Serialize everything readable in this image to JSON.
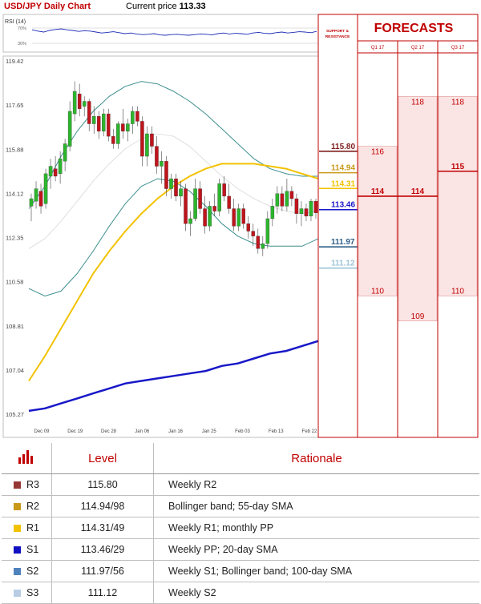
{
  "header": {
    "title": "USD/JPY Daily Chart",
    "current_label": "Current price",
    "current_value": "113.33"
  },
  "chart_data": {
    "type": "candlestick",
    "rsi_label": "RSI (14)",
    "rsi_levels": [
      "70%",
      "30%"
    ],
    "rsi_values": [
      62,
      58,
      55,
      60,
      63,
      65,
      62,
      60,
      57,
      59,
      58,
      55,
      52,
      54,
      56,
      53,
      50,
      52,
      49,
      47,
      48,
      50,
      46,
      45,
      47,
      48,
      46,
      45,
      47,
      49,
      48,
      46,
      50,
      52,
      49,
      51,
      50,
      48,
      52,
      54,
      51,
      50,
      53,
      55,
      52,
      54,
      56,
      55,
      53,
      57
    ],
    "y_ticks": [
      "119.42",
      "117.65",
      "115.88",
      "114.12",
      "112.35",
      "110.58",
      "108.81",
      "107.04",
      "105.27"
    ],
    "ylim": [
      105.27,
      119.42
    ],
    "x_ticks": [
      "Dec 09",
      "Dec 19",
      "Dec 28",
      "Jan 06",
      "Jan 16",
      "Jan 25",
      "Feb 03",
      "Feb 13",
      "Feb 22"
    ],
    "candles": [
      {
        "o": 113.6,
        "h": 114.1,
        "l": 113.0,
        "c": 113.9
      },
      {
        "o": 113.8,
        "h": 114.6,
        "l": 113.5,
        "c": 114.3
      },
      {
        "o": 114.2,
        "h": 114.5,
        "l": 113.3,
        "c": 113.6
      },
      {
        "o": 113.7,
        "h": 115.1,
        "l": 113.5,
        "c": 114.9
      },
      {
        "o": 114.8,
        "h": 115.5,
        "l": 114.3,
        "c": 115.2
      },
      {
        "o": 115.1,
        "h": 115.6,
        "l": 114.6,
        "c": 114.8
      },
      {
        "o": 114.9,
        "h": 115.8,
        "l": 114.5,
        "c": 115.5
      },
      {
        "o": 115.4,
        "h": 116.3,
        "l": 115.0,
        "c": 116.1
      },
      {
        "o": 116.0,
        "h": 117.8,
        "l": 115.8,
        "c": 117.4
      },
      {
        "o": 117.3,
        "h": 118.6,
        "l": 117.0,
        "c": 118.2
      },
      {
        "o": 118.1,
        "h": 118.5,
        "l": 117.2,
        "c": 117.5
      },
      {
        "o": 117.6,
        "h": 118.0,
        "l": 117.2,
        "c": 117.8
      },
      {
        "o": 117.8,
        "h": 117.9,
        "l": 116.6,
        "c": 116.9
      },
      {
        "o": 116.9,
        "h": 117.6,
        "l": 116.5,
        "c": 117.2
      },
      {
        "o": 117.2,
        "h": 117.4,
        "l": 116.3,
        "c": 116.6
      },
      {
        "o": 116.6,
        "h": 117.5,
        "l": 116.4,
        "c": 117.3
      },
      {
        "o": 117.3,
        "h": 117.5,
        "l": 116.2,
        "c": 116.4
      },
      {
        "o": 116.4,
        "h": 116.7,
        "l": 115.9,
        "c": 116.1
      },
      {
        "o": 116.1,
        "h": 117.0,
        "l": 115.9,
        "c": 116.9
      },
      {
        "o": 116.9,
        "h": 117.5,
        "l": 116.3,
        "c": 116.6
      },
      {
        "o": 116.6,
        "h": 117.1,
        "l": 116.2,
        "c": 116.9
      },
      {
        "o": 116.9,
        "h": 117.6,
        "l": 116.5,
        "c": 117.4
      },
      {
        "o": 117.4,
        "h": 117.6,
        "l": 116.8,
        "c": 117.0
      },
      {
        "o": 117.0,
        "h": 117.2,
        "l": 115.2,
        "c": 115.6
      },
      {
        "o": 115.6,
        "h": 116.8,
        "l": 115.2,
        "c": 116.5
      },
      {
        "o": 116.5,
        "h": 116.8,
        "l": 115.7,
        "c": 116.0
      },
      {
        "o": 116.0,
        "h": 116.4,
        "l": 114.9,
        "c": 115.2
      },
      {
        "o": 115.2,
        "h": 115.8,
        "l": 114.5,
        "c": 115.4
      },
      {
        "o": 115.4,
        "h": 115.6,
        "l": 114.0,
        "c": 114.3
      },
      {
        "o": 114.3,
        "h": 114.9,
        "l": 113.9,
        "c": 114.7
      },
      {
        "o": 114.7,
        "h": 114.9,
        "l": 113.8,
        "c": 114.0
      },
      {
        "o": 114.0,
        "h": 114.6,
        "l": 113.6,
        "c": 114.3
      },
      {
        "o": 114.3,
        "h": 114.5,
        "l": 112.6,
        "c": 112.9
      },
      {
        "o": 112.9,
        "h": 113.4,
        "l": 112.4,
        "c": 113.1
      },
      {
        "o": 113.1,
        "h": 114.7,
        "l": 113.0,
        "c": 114.3
      },
      {
        "o": 114.3,
        "h": 114.6,
        "l": 113.3,
        "c": 113.5
      },
      {
        "o": 113.5,
        "h": 114.0,
        "l": 112.5,
        "c": 112.8
      },
      {
        "o": 112.8,
        "h": 113.8,
        "l": 112.6,
        "c": 113.6
      },
      {
        "o": 113.6,
        "h": 114.1,
        "l": 113.2,
        "c": 113.4
      },
      {
        "o": 113.4,
        "h": 114.7,
        "l": 113.2,
        "c": 114.5
      },
      {
        "o": 114.5,
        "h": 114.8,
        "l": 113.8,
        "c": 114.0
      },
      {
        "o": 114.0,
        "h": 114.5,
        "l": 113.3,
        "c": 113.5
      },
      {
        "o": 113.5,
        "h": 113.9,
        "l": 112.6,
        "c": 112.8
      },
      {
        "o": 112.8,
        "h": 113.7,
        "l": 112.6,
        "c": 113.5
      },
      {
        "o": 113.5,
        "h": 113.7,
        "l": 112.7,
        "c": 112.9
      },
      {
        "o": 112.9,
        "h": 113.2,
        "l": 112.3,
        "c": 112.6
      },
      {
        "o": 112.6,
        "h": 112.9,
        "l": 112.0,
        "c": 112.4
      },
      {
        "o": 112.4,
        "h": 112.7,
        "l": 111.7,
        "c": 111.9
      },
      {
        "o": 111.9,
        "h": 112.4,
        "l": 111.6,
        "c": 112.1
      },
      {
        "o": 112.1,
        "h": 113.4,
        "l": 111.9,
        "c": 113.1
      },
      {
        "o": 113.1,
        "h": 113.9,
        "l": 112.8,
        "c": 113.6
      },
      {
        "o": 113.6,
        "h": 114.4,
        "l": 113.3,
        "c": 114.1
      },
      {
        "o": 114.1,
        "h": 114.4,
        "l": 113.4,
        "c": 113.6
      },
      {
        "o": 113.6,
        "h": 114.7,
        "l": 113.4,
        "c": 114.2
      },
      {
        "o": 114.2,
        "h": 114.4,
        "l": 113.6,
        "c": 113.9
      },
      {
        "o": 113.9,
        "h": 114.1,
        "l": 112.9,
        "c": 113.3
      },
      {
        "o": 113.3,
        "h": 113.8,
        "l": 112.8,
        "c": 113.5
      },
      {
        "o": 113.5,
        "h": 113.7,
        "l": 113.0,
        "c": 113.2
      },
      {
        "o": 113.2,
        "h": 113.9,
        "l": 113.0,
        "c": 113.8
      },
      {
        "o": 113.8,
        "h": 113.9,
        "l": 113.1,
        "c": 113.33
      }
    ],
    "indicators": {
      "bb_upper": [
        113.5,
        114.4,
        115.6,
        116.6,
        117.4,
        118.0,
        118.4,
        118.6,
        118.5,
        118.2,
        117.8,
        117.3,
        116.7,
        116.1,
        115.5,
        115.1,
        114.9,
        114.8,
        114.8
      ],
      "bb_lower": [
        110.3,
        110.0,
        110.2,
        110.9,
        111.8,
        112.8,
        113.7,
        114.4,
        114.7,
        114.6,
        114.2,
        113.6,
        112.9,
        112.4,
        112.1,
        112.0,
        112.0,
        112.0,
        112.3
      ],
      "bb_mid": [
        111.9,
        112.3,
        113.0,
        113.8,
        114.6,
        115.3,
        115.9,
        116.3,
        116.5,
        116.4,
        116.0,
        115.4,
        114.8,
        114.3,
        113.9,
        113.6,
        113.4,
        113.3,
        113.4
      ],
      "sma55": [
        106.6,
        107.6,
        108.7,
        109.8,
        110.9,
        111.8,
        112.6,
        113.3,
        113.9,
        114.4,
        114.8,
        115.1,
        115.3,
        115.3,
        115.3,
        115.2,
        115.1,
        114.9,
        114.7
      ],
      "sma100": [
        105.4,
        105.5,
        105.7,
        105.9,
        106.1,
        106.3,
        106.5,
        106.6,
        106.7,
        106.8,
        106.9,
        107.0,
        107.2,
        107.3,
        107.5,
        107.7,
        107.8,
        108.0,
        108.2
      ]
    },
    "levels": [
      {
        "name": "R3",
        "value": 115.8,
        "label": "115.80",
        "color": "#7f1d1d"
      },
      {
        "name": "R2",
        "value": 114.94,
        "label": "114.94",
        "color": "#c99a1a"
      },
      {
        "name": "R1",
        "value": 114.31,
        "label": "114.31",
        "color": "#f2c200"
      },
      {
        "name": "S1",
        "value": 113.46,
        "label": "113.46",
        "color": "#1818c8"
      },
      {
        "name": "S2",
        "value": 111.97,
        "label": "111.97",
        "color": "#2f5f86"
      },
      {
        "name": "S3",
        "value": 111.12,
        "label": "111.12",
        "color": "#9dc3d8"
      }
    ],
    "sr_header": "SUPPORT & RESISTANCE",
    "forecast_title": "FORECASTS",
    "forecast_columns": [
      "Q1 17",
      "Q2 17",
      "Q3 17"
    ],
    "forecasts": [
      {
        "quarter": "Q1 17",
        "high": 116,
        "mid": 114,
        "low": 110
      },
      {
        "quarter": "Q2 17",
        "high": 118,
        "mid": 114,
        "low": 109
      },
      {
        "quarter": "Q3 17",
        "high": 118,
        "mid": 115,
        "low": 110
      }
    ]
  },
  "table": {
    "header_level": "Level",
    "header_rationale": "Rationale",
    "rows": [
      {
        "name": "R3",
        "level": "115.80",
        "rationale": "Weekly R2",
        "color": "#953735"
      },
      {
        "name": "R2",
        "level": "114.94/98",
        "rationale": "Bollinger band; 55-day SMA",
        "color": "#c99a1a"
      },
      {
        "name": "R1",
        "level": "114.31/49",
        "rationale": "Weekly R1; monthly PP",
        "color": "#f2c200"
      },
      {
        "name": "S1",
        "level": "113.46/29",
        "rationale": "Weekly PP; 20-day SMA",
        "color": "#1010c0"
      },
      {
        "name": "S2",
        "level": "111.97/56",
        "rationale": "Weekly S1; Bollinger band; 100-day SMA",
        "color": "#4f81bd"
      },
      {
        "name": "S3",
        "level": "111.12",
        "rationale": "Weekly S2",
        "color": "#b8cce4"
      }
    ]
  },
  "colors": {
    "up": "#2db52d",
    "down": "#c0141c",
    "accent": "#c00000",
    "band": "#3f8f8f"
  }
}
